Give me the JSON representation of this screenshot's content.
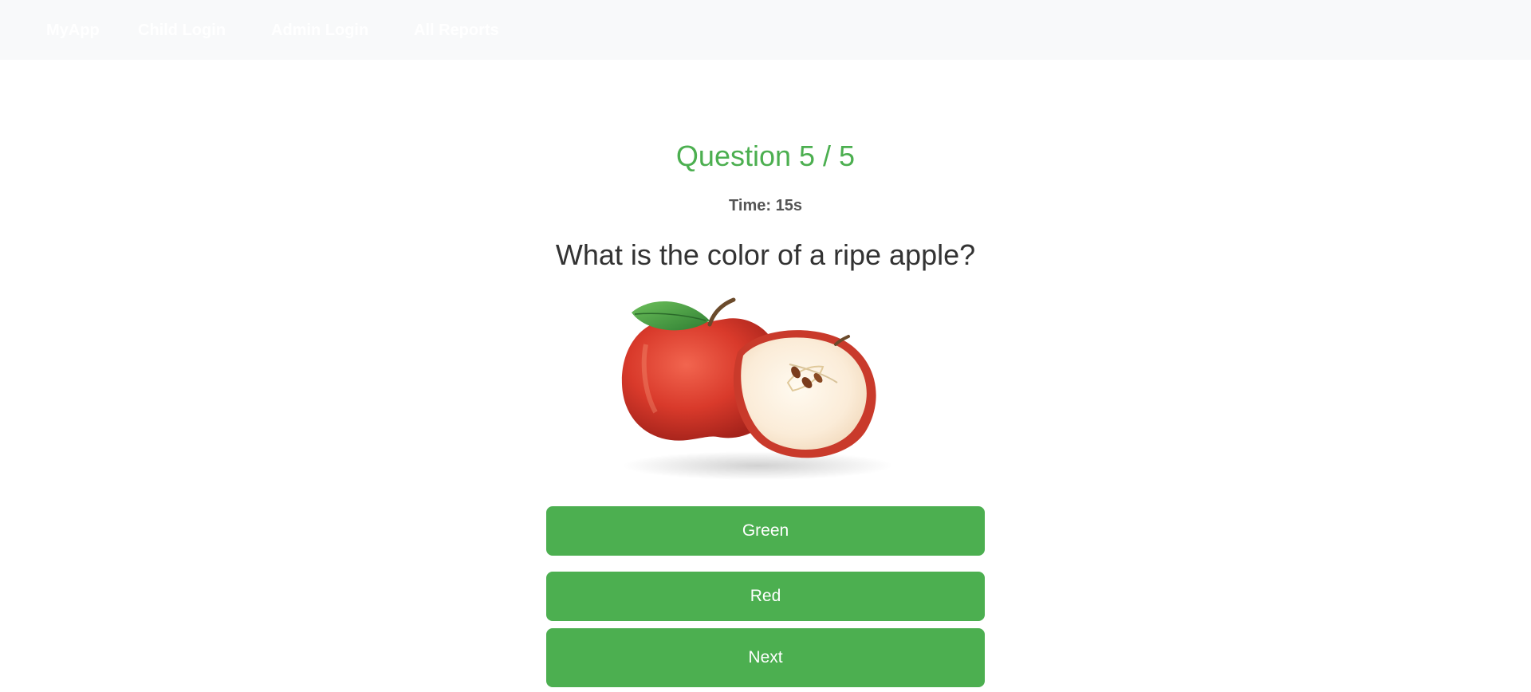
{
  "theme": {
    "accent": "#4caf50",
    "navbar_bg": "#f8f9fa"
  },
  "navbar": {
    "brand": "MyApp",
    "links": [
      {
        "label": "Child Login"
      },
      {
        "label": "Admin Login"
      },
      {
        "label": "All Reports"
      }
    ]
  },
  "quiz": {
    "counter": "Question 5 / 5",
    "timer": "Time: 15s",
    "question": "What is the color of a ripe apple?",
    "image_icon": "apple-image",
    "options": [
      {
        "label": "Green"
      },
      {
        "label": "Red"
      }
    ],
    "next_label": "Next"
  }
}
